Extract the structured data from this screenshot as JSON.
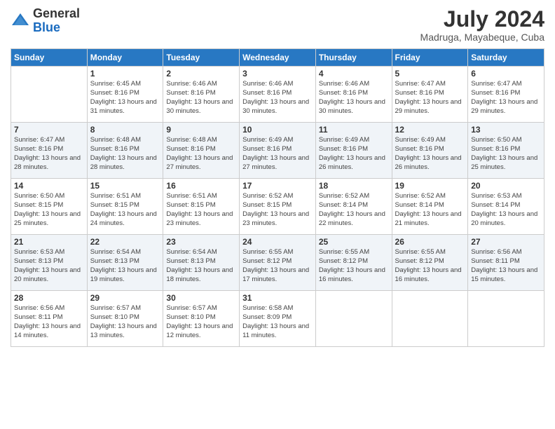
{
  "logo": {
    "general": "General",
    "blue": "Blue"
  },
  "title": "July 2024",
  "location": "Madruga, Mayabeque, Cuba",
  "days_of_week": [
    "Sunday",
    "Monday",
    "Tuesday",
    "Wednesday",
    "Thursday",
    "Friday",
    "Saturday"
  ],
  "weeks": [
    [
      {
        "day": "",
        "sunrise": "",
        "sunset": "",
        "daylight": ""
      },
      {
        "day": "1",
        "sunrise": "Sunrise: 6:45 AM",
        "sunset": "Sunset: 8:16 PM",
        "daylight": "Daylight: 13 hours and 31 minutes."
      },
      {
        "day": "2",
        "sunrise": "Sunrise: 6:46 AM",
        "sunset": "Sunset: 8:16 PM",
        "daylight": "Daylight: 13 hours and 30 minutes."
      },
      {
        "day": "3",
        "sunrise": "Sunrise: 6:46 AM",
        "sunset": "Sunset: 8:16 PM",
        "daylight": "Daylight: 13 hours and 30 minutes."
      },
      {
        "day": "4",
        "sunrise": "Sunrise: 6:46 AM",
        "sunset": "Sunset: 8:16 PM",
        "daylight": "Daylight: 13 hours and 30 minutes."
      },
      {
        "day": "5",
        "sunrise": "Sunrise: 6:47 AM",
        "sunset": "Sunset: 8:16 PM",
        "daylight": "Daylight: 13 hours and 29 minutes."
      },
      {
        "day": "6",
        "sunrise": "Sunrise: 6:47 AM",
        "sunset": "Sunset: 8:16 PM",
        "daylight": "Daylight: 13 hours and 29 minutes."
      }
    ],
    [
      {
        "day": "7",
        "sunrise": "Sunrise: 6:47 AM",
        "sunset": "Sunset: 8:16 PM",
        "daylight": "Daylight: 13 hours and 28 minutes."
      },
      {
        "day": "8",
        "sunrise": "Sunrise: 6:48 AM",
        "sunset": "Sunset: 8:16 PM",
        "daylight": "Daylight: 13 hours and 28 minutes."
      },
      {
        "day": "9",
        "sunrise": "Sunrise: 6:48 AM",
        "sunset": "Sunset: 8:16 PM",
        "daylight": "Daylight: 13 hours and 27 minutes."
      },
      {
        "day": "10",
        "sunrise": "Sunrise: 6:49 AM",
        "sunset": "Sunset: 8:16 PM",
        "daylight": "Daylight: 13 hours and 27 minutes."
      },
      {
        "day": "11",
        "sunrise": "Sunrise: 6:49 AM",
        "sunset": "Sunset: 8:16 PM",
        "daylight": "Daylight: 13 hours and 26 minutes."
      },
      {
        "day": "12",
        "sunrise": "Sunrise: 6:49 AM",
        "sunset": "Sunset: 8:16 PM",
        "daylight": "Daylight: 13 hours and 26 minutes."
      },
      {
        "day": "13",
        "sunrise": "Sunrise: 6:50 AM",
        "sunset": "Sunset: 8:16 PM",
        "daylight": "Daylight: 13 hours and 25 minutes."
      }
    ],
    [
      {
        "day": "14",
        "sunrise": "Sunrise: 6:50 AM",
        "sunset": "Sunset: 8:15 PM",
        "daylight": "Daylight: 13 hours and 25 minutes."
      },
      {
        "day": "15",
        "sunrise": "Sunrise: 6:51 AM",
        "sunset": "Sunset: 8:15 PM",
        "daylight": "Daylight: 13 hours and 24 minutes."
      },
      {
        "day": "16",
        "sunrise": "Sunrise: 6:51 AM",
        "sunset": "Sunset: 8:15 PM",
        "daylight": "Daylight: 13 hours and 23 minutes."
      },
      {
        "day": "17",
        "sunrise": "Sunrise: 6:52 AM",
        "sunset": "Sunset: 8:15 PM",
        "daylight": "Daylight: 13 hours and 23 minutes."
      },
      {
        "day": "18",
        "sunrise": "Sunrise: 6:52 AM",
        "sunset": "Sunset: 8:14 PM",
        "daylight": "Daylight: 13 hours and 22 minutes."
      },
      {
        "day": "19",
        "sunrise": "Sunrise: 6:52 AM",
        "sunset": "Sunset: 8:14 PM",
        "daylight": "Daylight: 13 hours and 21 minutes."
      },
      {
        "day": "20",
        "sunrise": "Sunrise: 6:53 AM",
        "sunset": "Sunset: 8:14 PM",
        "daylight": "Daylight: 13 hours and 20 minutes."
      }
    ],
    [
      {
        "day": "21",
        "sunrise": "Sunrise: 6:53 AM",
        "sunset": "Sunset: 8:13 PM",
        "daylight": "Daylight: 13 hours and 20 minutes."
      },
      {
        "day": "22",
        "sunrise": "Sunrise: 6:54 AM",
        "sunset": "Sunset: 8:13 PM",
        "daylight": "Daylight: 13 hours and 19 minutes."
      },
      {
        "day": "23",
        "sunrise": "Sunrise: 6:54 AM",
        "sunset": "Sunset: 8:13 PM",
        "daylight": "Daylight: 13 hours and 18 minutes."
      },
      {
        "day": "24",
        "sunrise": "Sunrise: 6:55 AM",
        "sunset": "Sunset: 8:12 PM",
        "daylight": "Daylight: 13 hours and 17 minutes."
      },
      {
        "day": "25",
        "sunrise": "Sunrise: 6:55 AM",
        "sunset": "Sunset: 8:12 PM",
        "daylight": "Daylight: 13 hours and 16 minutes."
      },
      {
        "day": "26",
        "sunrise": "Sunrise: 6:55 AM",
        "sunset": "Sunset: 8:12 PM",
        "daylight": "Daylight: 13 hours and 16 minutes."
      },
      {
        "day": "27",
        "sunrise": "Sunrise: 6:56 AM",
        "sunset": "Sunset: 8:11 PM",
        "daylight": "Daylight: 13 hours and 15 minutes."
      }
    ],
    [
      {
        "day": "28",
        "sunrise": "Sunrise: 6:56 AM",
        "sunset": "Sunset: 8:11 PM",
        "daylight": "Daylight: 13 hours and 14 minutes."
      },
      {
        "day": "29",
        "sunrise": "Sunrise: 6:57 AM",
        "sunset": "Sunset: 8:10 PM",
        "daylight": "Daylight: 13 hours and 13 minutes."
      },
      {
        "day": "30",
        "sunrise": "Sunrise: 6:57 AM",
        "sunset": "Sunset: 8:10 PM",
        "daylight": "Daylight: 13 hours and 12 minutes."
      },
      {
        "day": "31",
        "sunrise": "Sunrise: 6:58 AM",
        "sunset": "Sunset: 8:09 PM",
        "daylight": "Daylight: 13 hours and 11 minutes."
      },
      {
        "day": "",
        "sunrise": "",
        "sunset": "",
        "daylight": ""
      },
      {
        "day": "",
        "sunrise": "",
        "sunset": "",
        "daylight": ""
      },
      {
        "day": "",
        "sunrise": "",
        "sunset": "",
        "daylight": ""
      }
    ]
  ]
}
